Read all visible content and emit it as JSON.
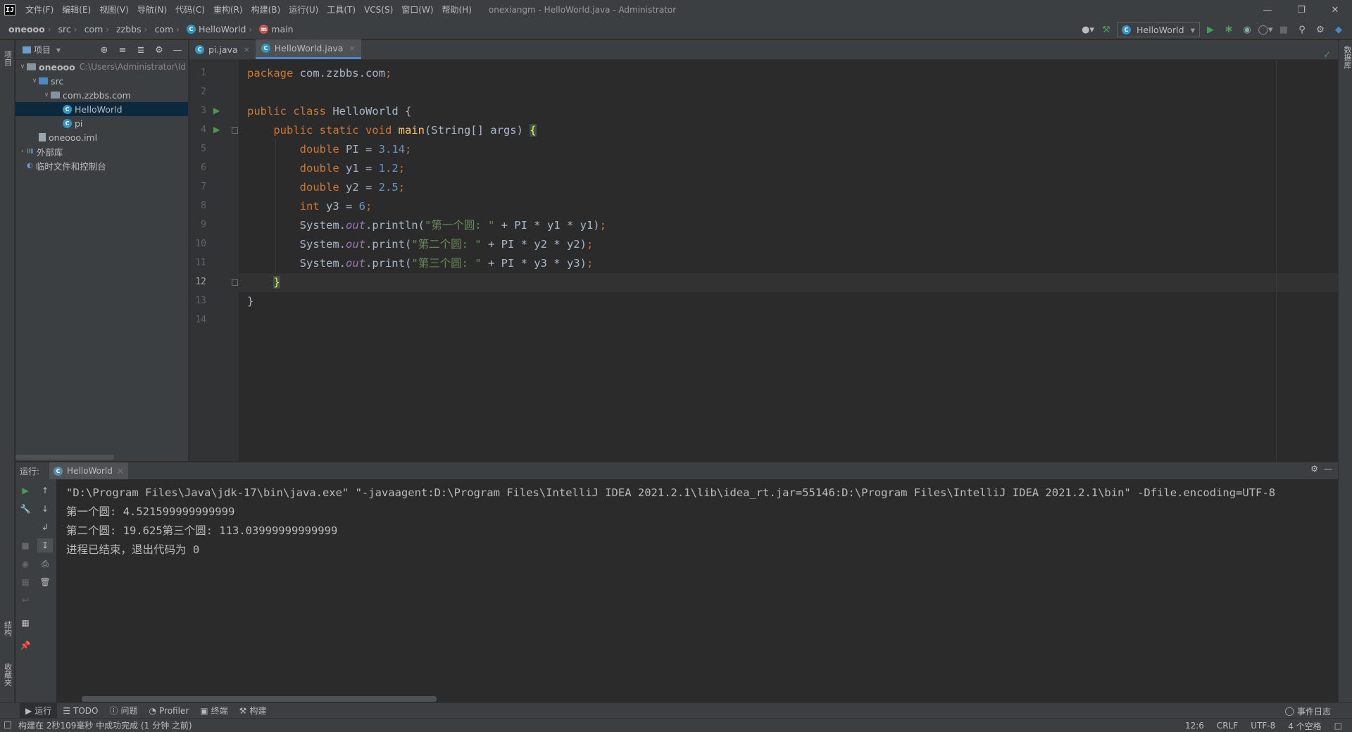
{
  "titlebar": {
    "menu": [
      "文件(F)",
      "编辑(E)",
      "视图(V)",
      "导航(N)",
      "代码(C)",
      "重构(R)",
      "构建(B)",
      "运行(U)",
      "工具(T)",
      "VCS(S)",
      "窗口(W)",
      "帮助(H)"
    ],
    "window_title": "onexiangm - HelloWorld.java - Administrator"
  },
  "breadcrumbs": [
    "oneooo",
    "src",
    "com",
    "zzbbs",
    "com",
    "HelloWorld",
    "main"
  ],
  "run_config": "HelloWorld",
  "project_panel": {
    "header": "项目",
    "tree": [
      {
        "label": "oneooo",
        "hint": "C:\\Users\\Administrator\\Id",
        "depth": 0,
        "arrow": "open",
        "icon": "folder",
        "bold": true
      },
      {
        "label": "src",
        "depth": 1,
        "arrow": "open",
        "icon": "folder-blue"
      },
      {
        "label": "com.zzbbs.com",
        "depth": 2,
        "arrow": "open",
        "icon": "folder"
      },
      {
        "label": "HelloWorld",
        "depth": 3,
        "icon": "java",
        "selected": true
      },
      {
        "label": "pi",
        "depth": 3,
        "icon": "java"
      },
      {
        "label": "oneooo.iml",
        "depth": 1,
        "icon": "file"
      },
      {
        "label": "外部库",
        "depth": 0,
        "arrow": "closed",
        "icon": "library"
      },
      {
        "label": "临时文件和控制台",
        "depth": 0,
        "icon": "scratch"
      }
    ]
  },
  "editor": {
    "tabs": [
      {
        "label": "pi.java",
        "active": false
      },
      {
        "label": "HelloWorld.java",
        "active": true
      }
    ],
    "current_line": 12,
    "line_numbers": [
      "1",
      "2",
      "3",
      "4",
      "5",
      "6",
      "7",
      "8",
      "9",
      "10",
      "11",
      "12",
      "13",
      "14"
    ],
    "lines": [
      [
        {
          "t": "package ",
          "c": "kw"
        },
        {
          "t": "com.zzbbs.com",
          "c": ""
        },
        {
          "t": ";",
          "c": "kw"
        }
      ],
      [],
      [
        {
          "t": "public class ",
          "c": "kw"
        },
        {
          "t": "HelloWorld {",
          "c": ""
        }
      ],
      [
        {
          "t": "    public static void ",
          "c": "kw"
        },
        {
          "t": "main",
          "c": "fn"
        },
        {
          "t": "(String[] args) ",
          "c": ""
        },
        {
          "t": "{",
          "c": "brace"
        }
      ],
      [
        {
          "t": "        double ",
          "c": "kw"
        },
        {
          "t": "PI = ",
          "c": ""
        },
        {
          "t": "3.14",
          "c": "num"
        },
        {
          "t": ";",
          "c": "kw"
        }
      ],
      [
        {
          "t": "        double ",
          "c": "kw"
        },
        {
          "t": "y1 = ",
          "c": ""
        },
        {
          "t": "1.2",
          "c": "num"
        },
        {
          "t": ";",
          "c": "kw"
        }
      ],
      [
        {
          "t": "        double ",
          "c": "kw"
        },
        {
          "t": "y2 = ",
          "c": ""
        },
        {
          "t": "2.5",
          "c": "num"
        },
        {
          "t": ";",
          "c": "kw"
        }
      ],
      [
        {
          "t": "        int ",
          "c": "kw"
        },
        {
          "t": "y3 = ",
          "c": ""
        },
        {
          "t": "6",
          "c": "num"
        },
        {
          "t": ";",
          "c": "kw"
        }
      ],
      [
        {
          "t": "        System.",
          "c": ""
        },
        {
          "t": "out",
          "c": "fld"
        },
        {
          "t": ".println(",
          "c": ""
        },
        {
          "t": "\"第一个圆: \"",
          "c": "str"
        },
        {
          "t": " + PI * y1 * y1)",
          "c": ""
        },
        {
          "t": ";",
          "c": "kw"
        }
      ],
      [
        {
          "t": "        System.",
          "c": ""
        },
        {
          "t": "out",
          "c": "fld"
        },
        {
          "t": ".print(",
          "c": ""
        },
        {
          "t": "\"第二个圆: \"",
          "c": "str"
        },
        {
          "t": " + PI * y2 * y2)",
          "c": ""
        },
        {
          "t": ";",
          "c": "kw"
        }
      ],
      [
        {
          "t": "        System.",
          "c": ""
        },
        {
          "t": "out",
          "c": "fld"
        },
        {
          "t": ".print(",
          "c": ""
        },
        {
          "t": "\"第三个圆: \"",
          "c": "str"
        },
        {
          "t": " + PI * y3 * y3)",
          "c": ""
        },
        {
          "t": ";",
          "c": "kw"
        }
      ],
      [
        {
          "t": "    ",
          "c": ""
        },
        {
          "t": "}",
          "c": "brace"
        }
      ],
      [
        {
          "t": "}",
          "c": ""
        }
      ],
      []
    ]
  },
  "run_window": {
    "label": "运行:",
    "tab": "HelloWorld",
    "console": [
      "\"D:\\Program Files\\Java\\jdk-17\\bin\\java.exe\" \"-javaagent:D:\\Program Files\\IntelliJ IDEA 2021.2.1\\lib\\idea_rt.jar=55146:D:\\Program Files\\IntelliJ IDEA 2021.2.1\\bin\" -Dfile.encoding=UTF-8",
      "第一个圆: 4.521599999999999",
      "第二个圆: 19.625第三个圆: 113.03999999999999",
      "进程已结束，退出代码为 0"
    ]
  },
  "tool_tabs": [
    "运行",
    "TODO",
    "问题",
    "Profiler",
    "终端",
    "构建"
  ],
  "event_log": "事件日志",
  "left_stripe": {
    "top": "项目",
    "structure": "结构",
    "favorites": "收藏夹"
  },
  "right_stripe": {
    "database": "数据库"
  },
  "status": {
    "message": "构建在 2秒109毫秒 中成功完成 (1 分钟 之前)",
    "position": "12:6",
    "line_sep": "CRLF",
    "encoding": "UTF-8",
    "indent": "4 个空格"
  }
}
